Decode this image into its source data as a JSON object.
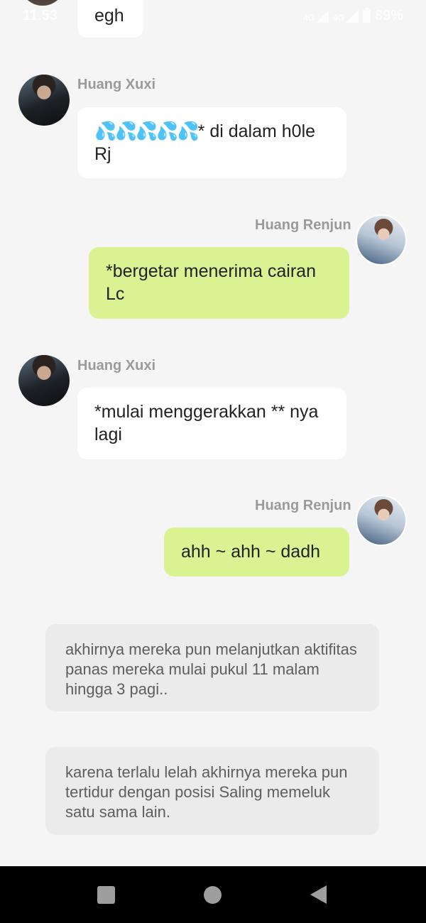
{
  "status_bar": {
    "time": "11.53",
    "network_1": "4G",
    "network_2": "4G",
    "battery": "89%"
  },
  "messages": [
    {
      "id": "m0",
      "sender": "",
      "direction": "incoming",
      "text": "egh"
    },
    {
      "id": "m1",
      "sender": "Huang Xuxi",
      "direction": "incoming",
      "emoji": "💦💦💦💦💦",
      "text": "* di dalam h0le Rj"
    },
    {
      "id": "m2",
      "sender": "Huang Renjun",
      "direction": "outgoing",
      "text": "*bergetar menerima cairan Lc"
    },
    {
      "id": "m3",
      "sender": "Huang Xuxi",
      "direction": "incoming",
      "text": "*mulai menggerakkan ** nya lagi"
    },
    {
      "id": "m4",
      "sender": "Huang Renjun",
      "direction": "outgoing",
      "text": "ahh ~ ahh ~ dadh"
    }
  ],
  "narrations": [
    {
      "text": "akhirnya mereka pun melanjutkan aktifitas panas mereka mulai pukul 11 malam hingga 3 pagi.."
    },
    {
      "text": "karena terlalu lelah akhirnya mereka pun tertidur dengan posisi Saling memeluk satu sama lain."
    }
  ],
  "colors": {
    "incoming_bubble": "#ffffff",
    "outgoing_bubble": "#d9f392",
    "narration_bubble": "#ebebeb",
    "background": "#f5f5f5"
  },
  "nav": {
    "recents": "recents-icon",
    "home": "home-icon",
    "back": "back-icon"
  }
}
